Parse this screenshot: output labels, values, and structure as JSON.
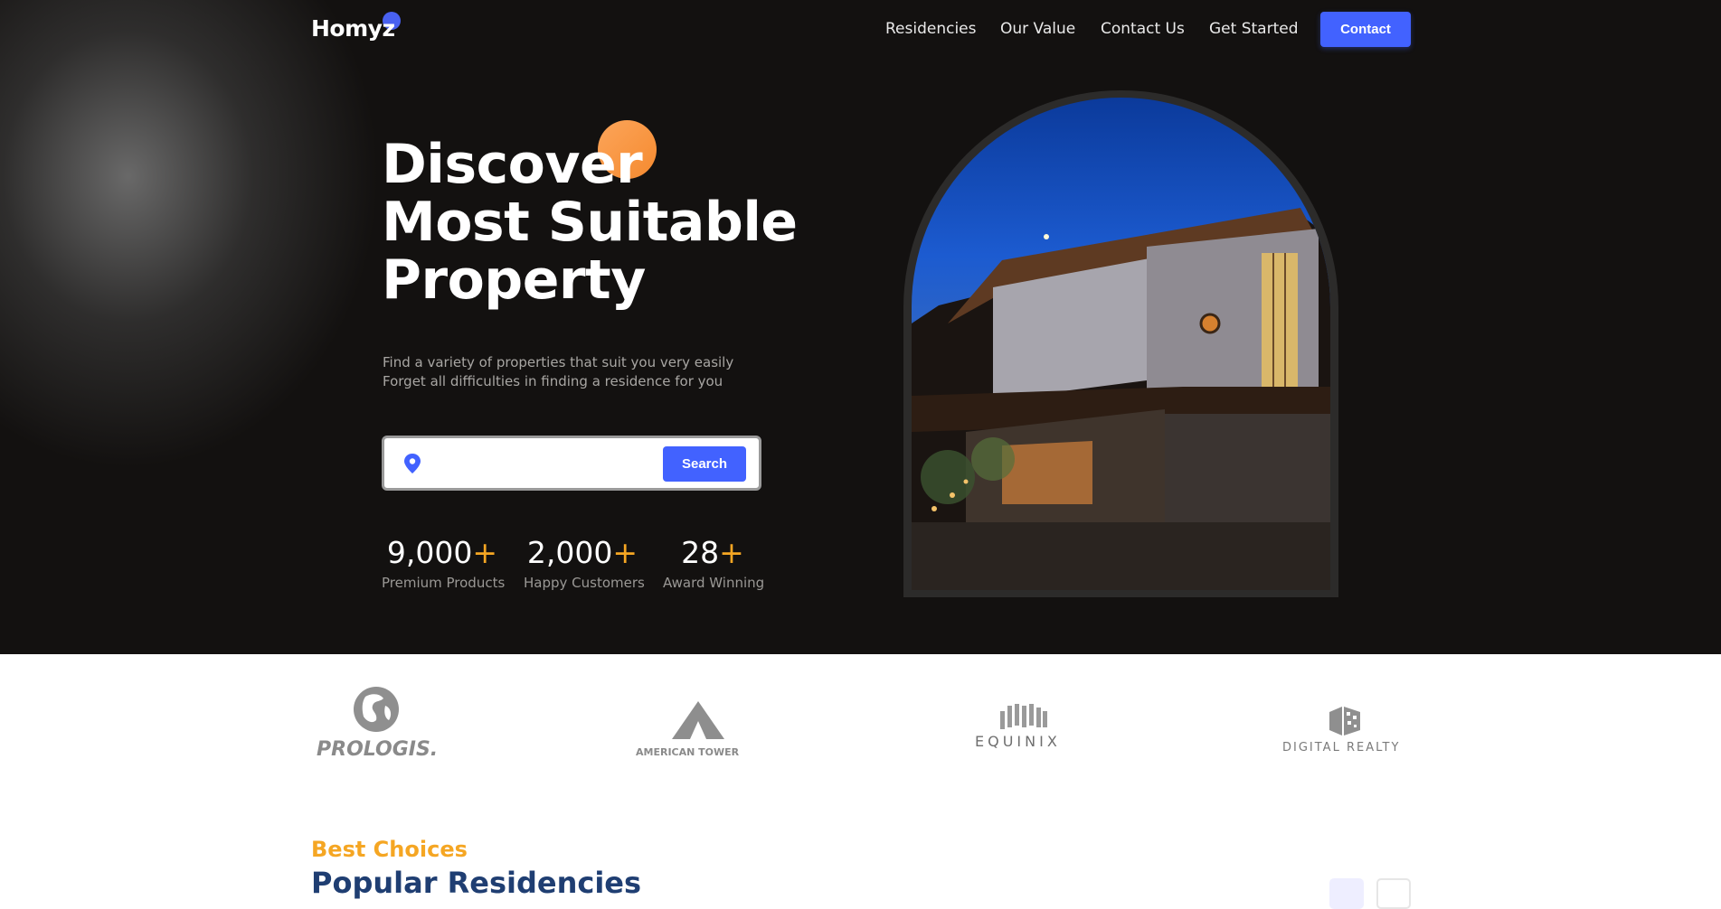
{
  "brand": {
    "logo_text": "Homyz",
    "accent_color": "#4262ff",
    "highlight_color": "#f5a623"
  },
  "nav": {
    "links": [
      "Residencies",
      "Our Value",
      "Contact Us",
      "Get Started"
    ],
    "cta_label": "Contact"
  },
  "hero": {
    "title_lines": [
      "Discover",
      "Most Suitable",
      "Property"
    ],
    "subtitle_lines": [
      "Find a variety of properties that suit you very easily",
      "Forget all difficulties in finding a residence for you"
    ],
    "search": {
      "icon": "location-pin-icon",
      "value": "",
      "button_label": "Search"
    },
    "stats": [
      {
        "number": "9,000",
        "suffix": "+",
        "label": "Premium Products"
      },
      {
        "number": "2,000",
        "suffix": "+",
        "label": "Happy Customers"
      },
      {
        "number": "28",
        "suffix": "+",
        "label": "Award Winning"
      }
    ],
    "image": "night-house-photo"
  },
  "companies": [
    {
      "name": "PROLOGIS.",
      "icon": "globe-icon"
    },
    {
      "name": "AMERICAN TOWER",
      "icon": "tower-triangle-icon"
    },
    {
      "name": "EQUINIX",
      "icon": "equinix-bars-icon"
    },
    {
      "name": "DIGITAL REALTY",
      "icon": "digital-cube-icon"
    }
  ],
  "residencies": {
    "kicker": "Best Choices",
    "title": "Popular Residencies"
  }
}
